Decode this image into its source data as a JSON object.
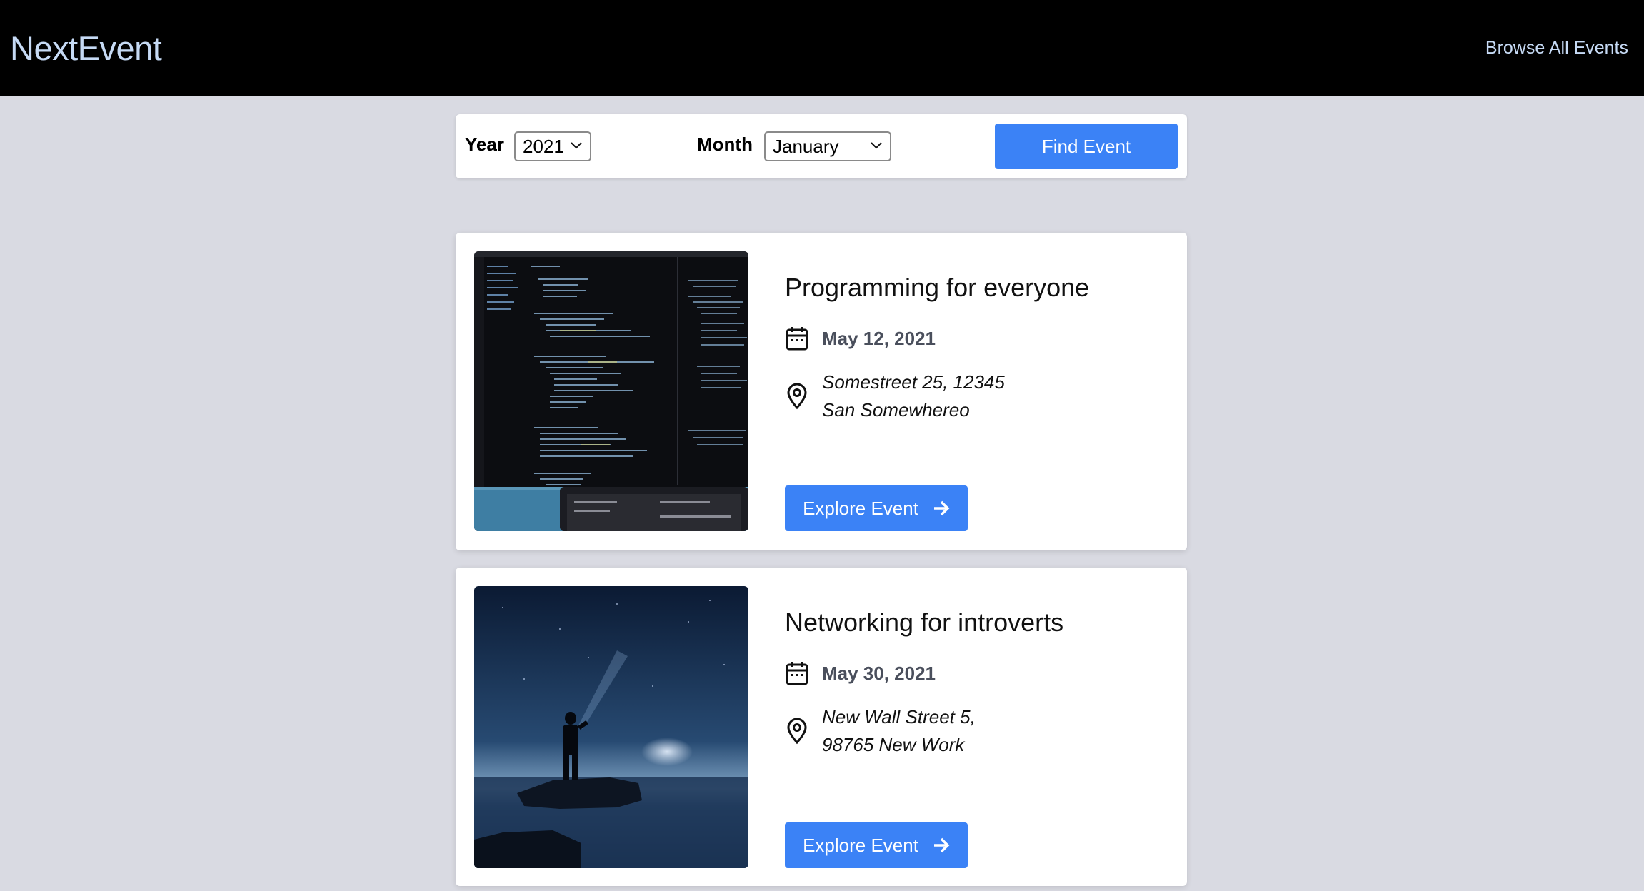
{
  "header": {
    "logo": "NextEvent",
    "nav_link": "Browse All Events"
  },
  "filter": {
    "year_label": "Year",
    "year_value": "2021",
    "month_label": "Month",
    "month_value": "January",
    "find_button": "Find Event"
  },
  "events": [
    {
      "title": "Programming for everyone",
      "date": "May 12, 2021",
      "address_line1": "Somestreet 25, 12345",
      "address_line2": "San Somewhereo",
      "button": "Explore Event",
      "image": "code-screen-photo"
    },
    {
      "title": "Networking for introverts",
      "date": "May 30, 2021",
      "address_line1": "New Wall Street 5,",
      "address_line2": "98765 New Work",
      "button": "Explore Event",
      "image": "night-sea-person-photo"
    }
  ],
  "colors": {
    "header_bg": "#000000",
    "logo": "#c6daf5",
    "page_bg": "#d9dae2",
    "accent": "#3b82f6"
  }
}
